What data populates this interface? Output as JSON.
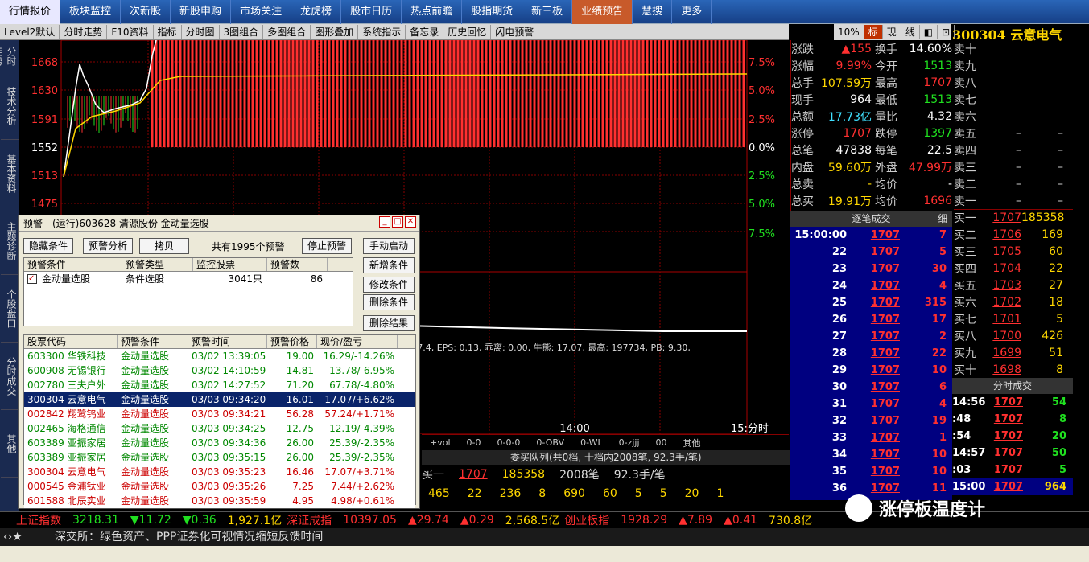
{
  "nav": [
    "行情报价",
    "板块监控",
    "次新股",
    "新股申购",
    "市场关注",
    "龙虎榜",
    "股市日历",
    "热点前瞻",
    "股指期货",
    "新三板",
    "业绩预告",
    "慧搜",
    "更多"
  ],
  "toolbar": [
    "Level2默认",
    "分时走势",
    "F10资料",
    "指标",
    "分时图",
    "3图组合",
    "多图组合",
    "图形叠加",
    "系统指示",
    "备忘录",
    "历史回忆",
    "闪电预警"
  ],
  "toolbar2": [
    "10%",
    "标",
    "现",
    "线",
    "◧",
    "⊡"
  ],
  "stock": {
    "code": "300304",
    "name": "云意电气"
  },
  "sidetabs": [
    "分时走势",
    "技术分析",
    "基本资料",
    "主题诊断",
    "个股盘口",
    "分时成交",
    "其他"
  ],
  "chart": {
    "price_labels": [
      "1668",
      "1630",
      "1591",
      "1552",
      "1513",
      "1475"
    ],
    "pct_labels": [
      "7.5%",
      "5.0%",
      "2.5%",
      "0.0%",
      "2.5%",
      "5.0%",
      "7.5%"
    ],
    "time_label": "14:00",
    "time_right": "15:分时",
    "info": "流: 7.4, EPS: 0.13, 乖离: 0.00, 牛熊: 17.07, 最高: 197734, PB: 9.30,",
    "subbar": [
      "+vol",
      "0-0",
      "0-0-0",
      "0-OBV",
      "0-WL",
      "0-zjjj",
      "00",
      "其他"
    ]
  },
  "quote": [
    [
      "涨跌",
      "▲155",
      "换手",
      "14.60%"
    ],
    [
      "涨幅",
      "9.99%",
      "今开",
      "1513"
    ],
    [
      "总手",
      "107.59万",
      "最高",
      "1707"
    ],
    [
      "现手",
      "964",
      "最低",
      "1513"
    ],
    [
      "总额",
      "17.73亿",
      "量比",
      "4.32"
    ],
    [
      "涨停",
      "1707",
      "跌停",
      "1397"
    ],
    [
      "总笔",
      "47838",
      "每笔",
      "22.5"
    ],
    [
      "内盘",
      "59.60万",
      "外盘",
      "47.99万"
    ],
    [
      "总卖",
      "-",
      "均价",
      "-"
    ],
    [
      "总买",
      "19.91万",
      "均价",
      "1696"
    ]
  ],
  "orderbook": [
    [
      "卖十",
      "",
      ""
    ],
    [
      "卖九",
      "",
      ""
    ],
    [
      "卖八",
      "",
      ""
    ],
    [
      "卖七",
      "",
      ""
    ],
    [
      "卖六",
      "",
      ""
    ],
    [
      "卖五",
      "–",
      "–"
    ],
    [
      "卖四",
      "–",
      "–"
    ],
    [
      "卖三",
      "–",
      "–"
    ],
    [
      "卖二",
      "–",
      "–"
    ],
    [
      "卖一",
      "–",
      "–"
    ],
    [
      "买一",
      "1707",
      "185358"
    ],
    [
      "买二",
      "1706",
      "169"
    ],
    [
      "买三",
      "1705",
      "60"
    ],
    [
      "买四",
      "1704",
      "22"
    ],
    [
      "买五",
      "1703",
      "27"
    ],
    [
      "买六",
      "1702",
      "18"
    ],
    [
      "买七",
      "1701",
      "5"
    ],
    [
      "买八",
      "1700",
      "426"
    ],
    [
      "买九",
      "1699",
      "51"
    ],
    [
      "买十",
      "1698",
      "8"
    ]
  ],
  "ticks_title": "逐笔成交",
  "ticks_detail": "细",
  "ticks": [
    [
      "15:00:00",
      "1707",
      "7"
    ],
    [
      "22",
      "1707",
      "5"
    ],
    [
      "23",
      "1707",
      "30"
    ],
    [
      "24",
      "1707",
      "4"
    ],
    [
      "25",
      "1707",
      "315"
    ],
    [
      "26",
      "1707",
      "17"
    ],
    [
      "27",
      "1707",
      "2"
    ],
    [
      "28",
      "1707",
      "22"
    ],
    [
      "29",
      "1707",
      "10"
    ],
    [
      "30",
      "1707",
      "6"
    ],
    [
      "31",
      "1707",
      "4"
    ],
    [
      "32",
      "1707",
      "19"
    ],
    [
      "33",
      "1707",
      "1"
    ],
    [
      "34",
      "1707",
      "10"
    ],
    [
      "35",
      "1707",
      "10"
    ],
    [
      "36",
      "1707",
      "11"
    ]
  ],
  "rticks_title": "分时成交",
  "rticks": [
    [
      "14:56",
      "1707",
      "54"
    ],
    [
      ":48",
      "1707",
      "8"
    ],
    [
      ":54",
      "1707",
      "20"
    ],
    [
      "14:57",
      "1707",
      "50"
    ],
    [
      ":03",
      "1707",
      "5"
    ],
    [
      "15:00",
      "1707",
      "964"
    ]
  ],
  "dialog": {
    "title": "预警 - (运行)603628 清源股份 金动量选股",
    "buttons": [
      "隐藏条件",
      "预警分析",
      "拷贝",
      "停止预警",
      "手动启动"
    ],
    "count_text": "共有1995个预警",
    "side_buttons": [
      "新增条件",
      "修改条件",
      "删除条件",
      "删除结果"
    ],
    "cond_headers": [
      "预警条件",
      "预警类型",
      "监控股票",
      "预警数"
    ],
    "cond_row": [
      "金动量选股",
      "条件选股",
      "3041只",
      "86"
    ],
    "list_headers": [
      "股票代码",
      "预警条件",
      "预警时间",
      "预警价格",
      "现价/盈亏"
    ],
    "list": [
      [
        "603300 华铁科技",
        "金动量选股",
        "03/02 13:39:05",
        "19.00",
        "16.29/-14.26%"
      ],
      [
        "600908 无锡银行",
        "金动量选股",
        "03/02 14:10:59",
        "14.81",
        "13.78/-6.95%"
      ],
      [
        "002780 三夫户外",
        "金动量选股",
        "03/02 14:27:52",
        "71.20",
        "67.78/-4.80%"
      ],
      [
        "300304 云意电气",
        "金动量选股",
        "03/03 09:34:20",
        "16.01",
        "17.07/+6.62%"
      ],
      [
        "002842 翔鹭钨业",
        "金动量选股",
        "03/03 09:34:21",
        "56.28",
        "57.24/+1.71%"
      ],
      [
        "002465 海格通信",
        "金动量选股",
        "03/03 09:34:25",
        "12.75",
        "12.19/-4.39%"
      ],
      [
        "603389 亚振家居",
        "金动量选股",
        "03/03 09:34:36",
        "26.00",
        "25.39/-2.35%"
      ],
      [
        "603389 亚振家居",
        "金动量选股",
        "03/03 09:35:15",
        "26.00",
        "25.39/-2.35%"
      ],
      [
        "300304 云意电气",
        "金动量选股",
        "03/03 09:35:23",
        "16.46",
        "17.07/+3.71%"
      ],
      [
        "000545 金浦钛业",
        "金动量选股",
        "03/03 09:35:26",
        "7.25",
        "7.44/+2.62%"
      ],
      [
        "601588 北辰实业",
        "金动量选股",
        "03/03 09:35:59",
        "4.95",
        "4.98/+0.61%"
      ]
    ]
  },
  "queue": {
    "title": "委买队列(共0档, 十档内2008笔, 92.3手/笔)",
    "row1": [
      "买一",
      "1707",
      "185358",
      "2008笔",
      "92.3手/笔"
    ],
    "row2": [
      "465",
      "22",
      "236",
      "8",
      "690",
      "60",
      "5",
      "5",
      "20",
      "1"
    ]
  },
  "bottom": [
    [
      "上证指数",
      "3218.31",
      "▼11.72",
      "▼0.36",
      "1,927.1亿"
    ],
    [
      "深证成指",
      "10397.05",
      "▲29.74",
      "▲0.29",
      "2,568.5亿"
    ],
    [
      "创业板指",
      "1928.29",
      "▲7.89",
      "▲0.41",
      "730.8亿"
    ]
  ],
  "ticker": "深交所：绿色资产、PPP证券化可视情况缩短反馈时间",
  "watermark": "涨停板温度计"
}
